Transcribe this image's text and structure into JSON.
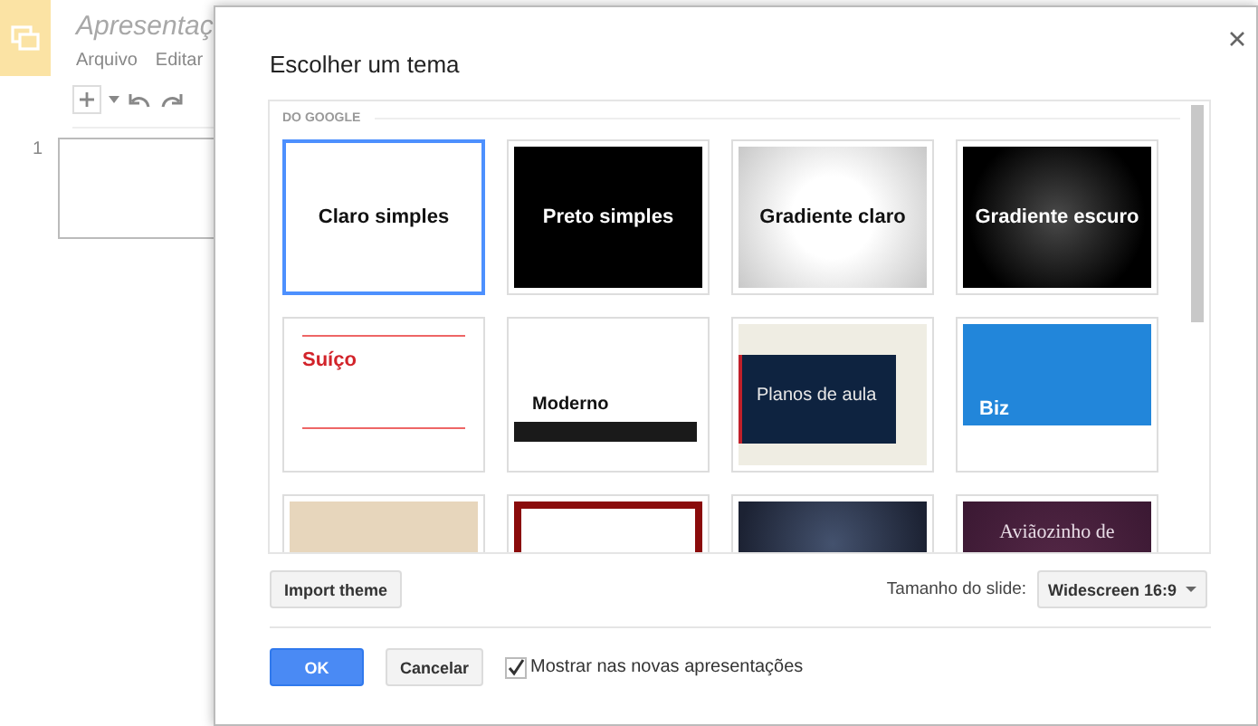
{
  "app": {
    "title": "Apresentaç",
    "menu": [
      "Arquivo",
      "Editar"
    ],
    "slides": [
      {
        "number": "1"
      }
    ]
  },
  "dialog": {
    "title": "Escolher um tema",
    "section": "DO GOOGLE",
    "themes": [
      {
        "kind": "plain-light",
        "title": "Claro simples",
        "selected": true
      },
      {
        "kind": "plain-dark",
        "title": "Preto simples",
        "selected": false
      },
      {
        "kind": "gradient-light",
        "title": "Gradiente claro",
        "selected": false
      },
      {
        "kind": "gradient-dark",
        "title": "Gradiente escuro",
        "selected": false
      },
      {
        "kind": "swiss",
        "title": "Suíço",
        "selected": false
      },
      {
        "kind": "modern",
        "title": "Moderno",
        "selected": false
      },
      {
        "kind": "lesson",
        "title": "Planos de aula",
        "selected": false
      },
      {
        "kind": "biz",
        "title": "Biz",
        "selected": false
      },
      {
        "kind": "beige",
        "selected": false
      },
      {
        "kind": "red-frame",
        "selected": false
      },
      {
        "kind": "dark-blue",
        "selected": false
      },
      {
        "kind": "purple",
        "title": "Aviãozinho de",
        "selected": false
      }
    ],
    "import_button": "Import theme",
    "slide_size": {
      "label": "Tamanho do slide:",
      "value": "Widescreen 16:9"
    },
    "ok_button": "OK",
    "cancel_button": "Cancelar",
    "show_in_new": {
      "label": "Mostrar nas novas apresentações",
      "checked": true
    }
  }
}
